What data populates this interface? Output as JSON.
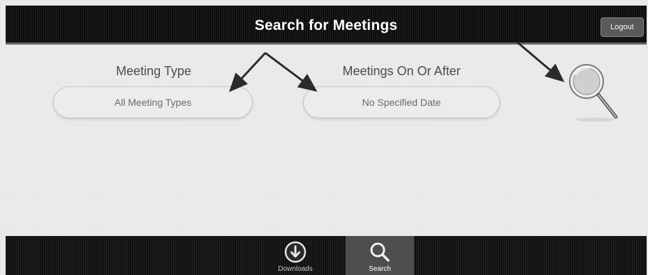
{
  "header": {
    "title": "Search for Meetings",
    "logout_label": "Logout"
  },
  "search_form": {
    "meeting_type": {
      "label": "Meeting Type",
      "value": "All Meeting Types"
    },
    "meetings_after": {
      "label": "Meetings On Or After",
      "value": "No Specified Date"
    },
    "search_icon": "magnifier-icon"
  },
  "tab_bar": {
    "tabs": [
      {
        "label": "Downloads",
        "icon": "download-icon",
        "selected": false
      },
      {
        "label": "Search",
        "icon": "search-icon",
        "selected": true
      }
    ]
  },
  "colors": {
    "bar_background": "#111111",
    "field_background": "#ececec",
    "text": "#4a4a4a",
    "selected_tab": "#4e4e4e"
  }
}
